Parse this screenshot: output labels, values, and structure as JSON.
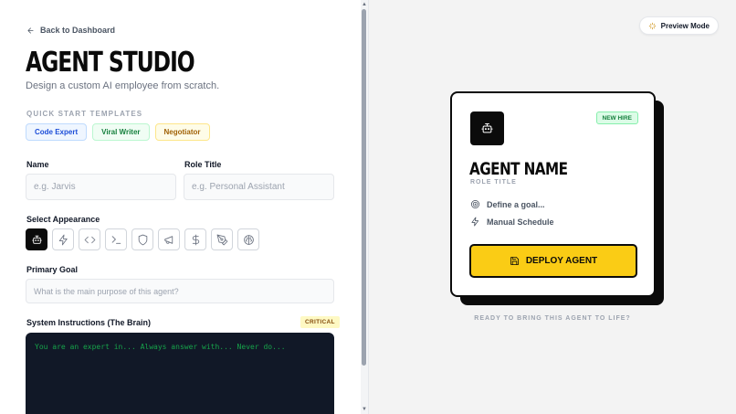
{
  "header": {
    "back_label": "Back to Dashboard",
    "title": "AGENT STUDIO",
    "subtitle": "Design a custom AI employee from scratch."
  },
  "templates": {
    "caption": "QUICK START TEMPLATES",
    "items": [
      {
        "label": "Code Expert",
        "color": "#1d4ed8"
      },
      {
        "label": "Viral Writer",
        "color": "#15803d"
      },
      {
        "label": "Negotiator",
        "color": "#a16207"
      }
    ]
  },
  "form": {
    "name_label": "Name",
    "name_placeholder": "e.g. Jarvis",
    "role_label": "Role Title",
    "role_placeholder": "e.g. Personal Assistant",
    "appearance_label": "Select Appearance",
    "appearance_icons": [
      "bot",
      "zap",
      "code",
      "terminal",
      "shield",
      "megaphone",
      "dollar",
      "pen-tool",
      "brain"
    ],
    "selected_icon": "bot",
    "goal_label": "Primary Goal",
    "goal_placeholder": "What is the main purpose of this agent?",
    "instructions_label": "System Instructions (The Brain)",
    "instructions_badge": "CRITICAL",
    "instructions_placeholder": "You are an expert in... Always answer with... Never do..."
  },
  "preview": {
    "mode_label": "Preview Mode",
    "badge": "NEW HIRE",
    "agent_name": "AGENT NAME",
    "role_title": "ROLE TITLE",
    "goal_text": "Define a goal...",
    "schedule_text": "Manual Schedule",
    "deploy_label": "DEPLOY AGENT",
    "footer": "READY TO BRING THIS AGENT TO LIFE?",
    "accent_color": "#facc15"
  }
}
